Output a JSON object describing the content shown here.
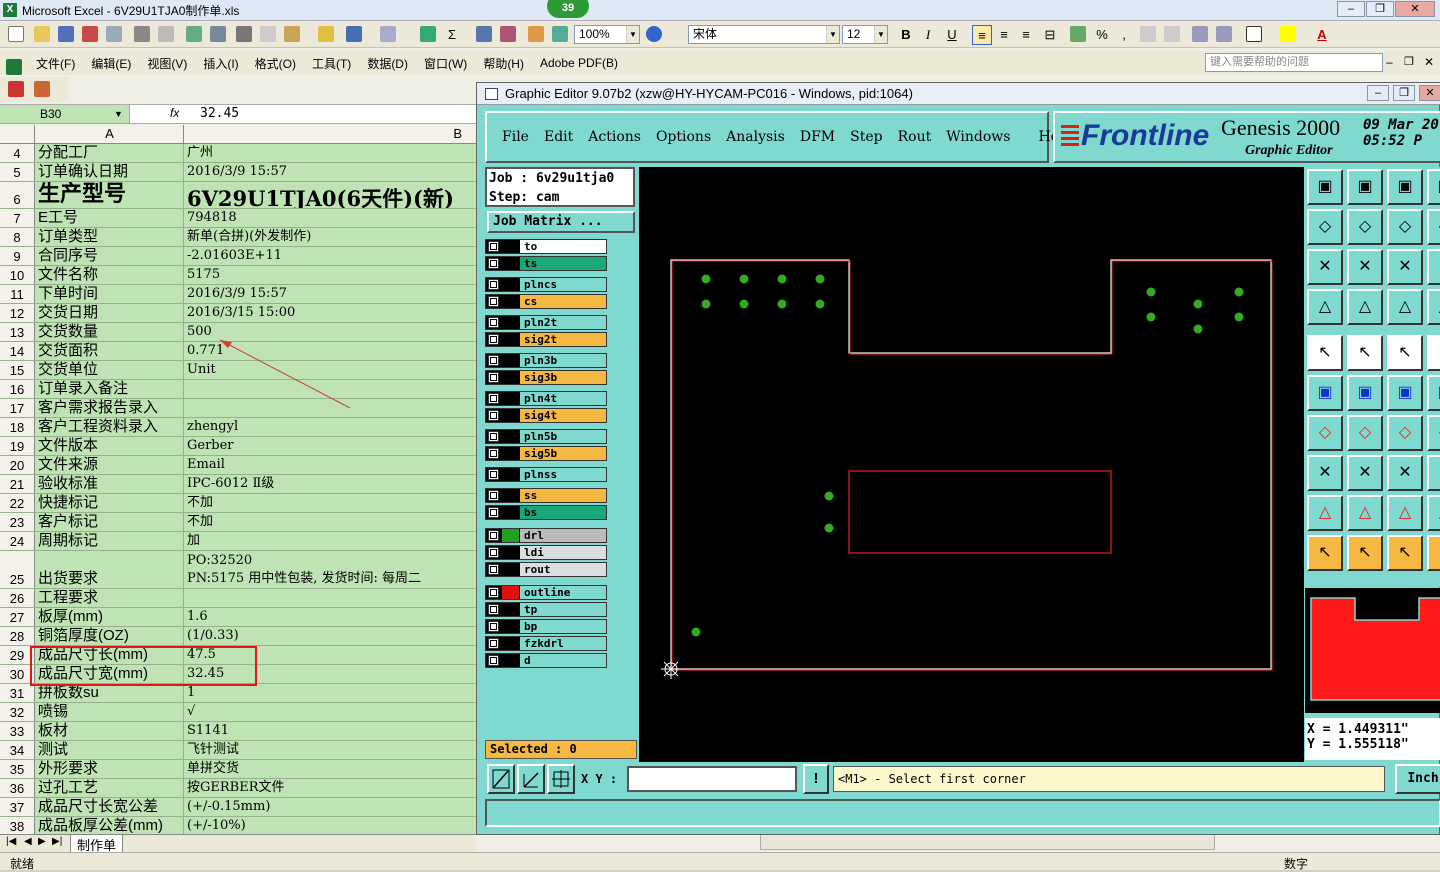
{
  "excel": {
    "title": "Microsoft Excel - 6V29U1TJA0制作单.xls",
    "badge": "39",
    "zoom": "100%",
    "font_name": "宋体",
    "font_size": "12",
    "menu": [
      "文件(F)",
      "编辑(E)",
      "视图(V)",
      "插入(I)",
      "格式(O)",
      "工具(T)",
      "数据(D)",
      "窗口(W)",
      "帮助(H)",
      "Adobe PDF(B)"
    ],
    "help_placeholder": "键入需要帮助的问题",
    "name_box": "B30",
    "fx": "fx",
    "formula_value": "32.45",
    "col_a": "A",
    "col_b": "B",
    "rows": [
      {
        "n": "4",
        "a": "分配工厂",
        "b": "广州"
      },
      {
        "n": "5",
        "a": "订单确认日期",
        "b": "2016/3/9 15:57"
      },
      {
        "n": "6",
        "a": "生产型号",
        "b": "6V29U1TJA0(6天件)(新)"
      },
      {
        "n": "7",
        "a": "E工号",
        "b": "794818"
      },
      {
        "n": "8",
        "a": "订单类型",
        "b": "新单(合拼)(外发制作)"
      },
      {
        "n": "9",
        "a": "合同序号",
        "b": "-2.01603E+11"
      },
      {
        "n": "10",
        "a": "文件名称",
        "b": "5175"
      },
      {
        "n": "11",
        "a": "下单时间",
        "b": "2016/3/9 15:57"
      },
      {
        "n": "12",
        "a": "交货日期",
        "b": "2016/3/15 15:00"
      },
      {
        "n": "13",
        "a": "交货数量",
        "b": "500"
      },
      {
        "n": "14",
        "a": "交货面积",
        "b": "0.771"
      },
      {
        "n": "15",
        "a": "交货单位",
        "b": "Unit"
      },
      {
        "n": "16",
        "a": "订单录入备注",
        "b": ""
      },
      {
        "n": "17",
        "a": "客户需求报告录入",
        "b": ""
      },
      {
        "n": "18",
        "a": "客户工程资料录入",
        "b": "zhengyl"
      },
      {
        "n": "19",
        "a": "文件版本",
        "b": "Gerber"
      },
      {
        "n": "20",
        "a": "文件来源",
        "b": "Email"
      },
      {
        "n": "21",
        "a": "验收标准",
        "b": "IPC-6012 Ⅱ级"
      },
      {
        "n": "22",
        "a": "快捷标记",
        "b": "不加"
      },
      {
        "n": "23",
        "a": "客户标记",
        "b": "不加"
      },
      {
        "n": "24",
        "a": "周期标记",
        "b": "加"
      },
      {
        "n": "25",
        "a": "出货要求",
        "b": "PO:32520",
        "b2": "PN:5175 用中性包装, 发货时间: 每周二"
      },
      {
        "n": "26",
        "a": "工程要求",
        "b": ""
      },
      {
        "n": "27",
        "a": "板厚(mm)",
        "b": "1.6"
      },
      {
        "n": "28",
        "a": "铜箔厚度(OZ)",
        "b": " (1/0.33)"
      },
      {
        "n": "29",
        "a": "成品尺寸长(mm)",
        "b": "47.5"
      },
      {
        "n": "30",
        "a": "成品尺寸宽(mm)",
        "b": "32.45"
      },
      {
        "n": "31",
        "a": "拼板数su",
        "b": "1"
      },
      {
        "n": "32",
        "a": "喷锡",
        "b": "√"
      },
      {
        "n": "33",
        "a": "板材",
        "b": "S1141"
      },
      {
        "n": "34",
        "a": "测试",
        "b": "飞针测试"
      },
      {
        "n": "35",
        "a": "外形要求",
        "b": "单拼交货"
      },
      {
        "n": "36",
        "a": "过孔工艺",
        "b": "按GERBER文件"
      },
      {
        "n": "37",
        "a": "成品尺寸长宽公差",
        "b": "(+/-0.15mm)"
      },
      {
        "n": "38",
        "a": "成品板厚公差(mm)",
        "b": "(+/-10%)"
      }
    ],
    "sheet_tab": "制作单",
    "status_left": "就绪",
    "status_right": "数字"
  },
  "genesis": {
    "title": "Graphic Editor 9.07b2 (xzw@HY-HYCAM-PC016 - Windows, pid:1064)",
    "menu": [
      "File",
      "Edit",
      "Actions",
      "Options",
      "Analysis",
      "DFM",
      "Step",
      "Rout",
      "Windows",
      "Help"
    ],
    "logo": "Frontline",
    "product": "Genesis 2000",
    "subtitle": "Graphic Editor",
    "date": "09 Mar 20",
    "time": "05:52 P",
    "job_line": "Job : 6v29u1tja0",
    "step_line": "Step: cam",
    "job_matrix": "Job Matrix ...",
    "layers": [
      {
        "name": "to",
        "color": "#ffffff",
        "swatch": "#000000"
      },
      {
        "name": "ts",
        "color": "#1aa87a",
        "swatch": "#000000"
      },
      {
        "name": "plncs",
        "color": "#7fd9cf",
        "swatch": "#000000"
      },
      {
        "name": "cs",
        "color": "#f5b942",
        "swatch": "#000000"
      },
      {
        "name": "pln2t",
        "color": "#7fd9cf",
        "swatch": "#000000"
      },
      {
        "name": "sig2t",
        "color": "#f5b942",
        "swatch": "#000000"
      },
      {
        "name": "pln3b",
        "color": "#7fd9cf",
        "swatch": "#000000"
      },
      {
        "name": "sig3b",
        "color": "#f5b942",
        "swatch": "#000000"
      },
      {
        "name": "pln4t",
        "color": "#7fd9cf",
        "swatch": "#000000"
      },
      {
        "name": "sig4t",
        "color": "#f5b942",
        "swatch": "#000000"
      },
      {
        "name": "pln5b",
        "color": "#7fd9cf",
        "swatch": "#000000"
      },
      {
        "name": "sig5b",
        "color": "#f5b942",
        "swatch": "#000000"
      },
      {
        "name": "plnss",
        "color": "#7fd9cf",
        "swatch": "#000000"
      },
      {
        "name": "ss",
        "color": "#f5b942",
        "swatch": "#000000"
      },
      {
        "name": "bs",
        "color": "#1aa87a",
        "swatch": "#000000"
      },
      {
        "name": "drl",
        "color": "#bbbbbb",
        "swatch": "#22a022"
      },
      {
        "name": "ldi",
        "color": "#dddddd",
        "swatch": "#000000"
      },
      {
        "name": "rout",
        "color": "#dddddd",
        "swatch": "#000000"
      },
      {
        "name": "outline",
        "color": "#7fd9cf",
        "swatch": "#e01010"
      },
      {
        "name": "tp",
        "color": "#7fd9cf",
        "swatch": "#000000"
      },
      {
        "name": "bp",
        "color": "#7fd9cf",
        "swatch": "#000000"
      },
      {
        "name": "fzkdrl",
        "color": "#7fd9cf",
        "swatch": "#000000"
      },
      {
        "name": "d",
        "color": "#7fd9cf",
        "swatch": "#000000"
      }
    ],
    "selected": "Selected : 0",
    "x_coord": "X = 1.449311\"",
    "y_coord": "Y = 1.555118\"",
    "xy_label": "X Y :",
    "message": "<M1> - Select first corner",
    "units": "Inch"
  }
}
